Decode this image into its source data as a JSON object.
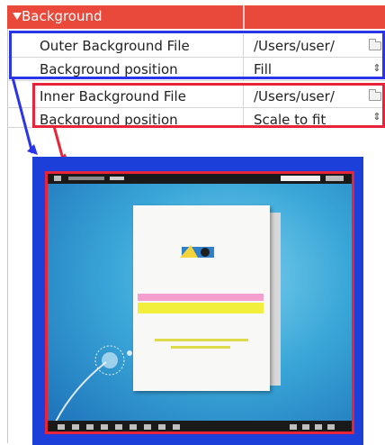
{
  "section": {
    "title": "Background"
  },
  "rows": [
    {
      "label": "Outer Background File",
      "value": "/Users/user/",
      "control": "folder-icon"
    },
    {
      "label": "Background position",
      "value": "Fill",
      "control": "stepper-icon"
    },
    {
      "label": "Inner Background File",
      "value": "/Users/user/",
      "control": "folder-icon"
    },
    {
      "label": "Background position",
      "value": "Scale to fit",
      "control": "stepper-icon"
    }
  ],
  "stepper_glyph": "⇕",
  "colors": {
    "section_header": "#e8493a",
    "blue_highlight": "#2a34e8",
    "red_highlight": "#e8243a"
  }
}
